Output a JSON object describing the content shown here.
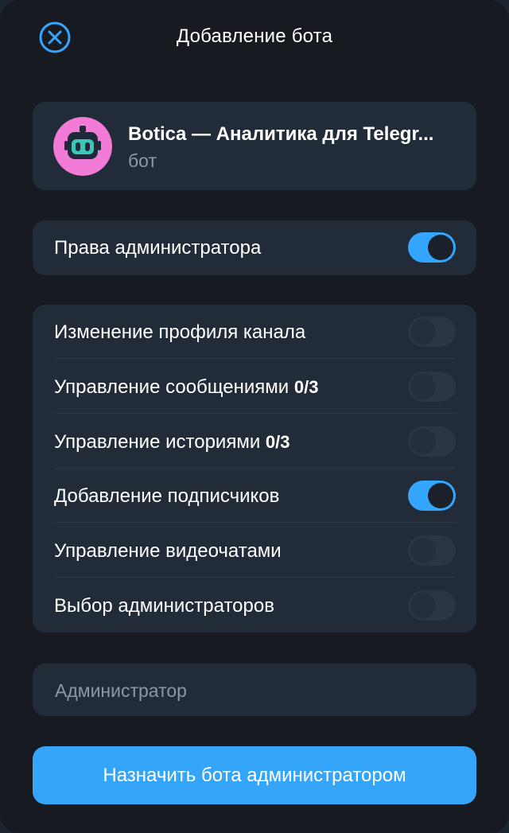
{
  "header": {
    "title": "Добавление бота"
  },
  "bot": {
    "name": "Botica — Аналитика для Telegr...",
    "subtitle": "бот"
  },
  "admin_rights": {
    "label": "Права администратора",
    "enabled": true
  },
  "permissions": [
    {
      "label": "Изменение профиля канала",
      "count": "",
      "enabled": false
    },
    {
      "label": "Управление сообщениями ",
      "count": "0/3",
      "enabled": false
    },
    {
      "label": "Управление историями ",
      "count": "0/3",
      "enabled": false
    },
    {
      "label": "Добавление подписчиков",
      "count": "",
      "enabled": true
    },
    {
      "label": "Управление видеочатами",
      "count": "",
      "enabled": false
    },
    {
      "label": "Выбор администраторов",
      "count": "",
      "enabled": false
    }
  ],
  "role_field": {
    "placeholder": "Администратор",
    "value": ""
  },
  "submit": {
    "label": "Назначить бота администратором"
  },
  "colors": {
    "accent": "#34a6ff",
    "background": "#171b21",
    "card": "#222c38",
    "avatar_bg": "#f27bd8",
    "avatar_face": "#3dc5b6"
  },
  "icons": {
    "close": "close-circle-icon",
    "avatar": "robot-avatar-icon"
  }
}
